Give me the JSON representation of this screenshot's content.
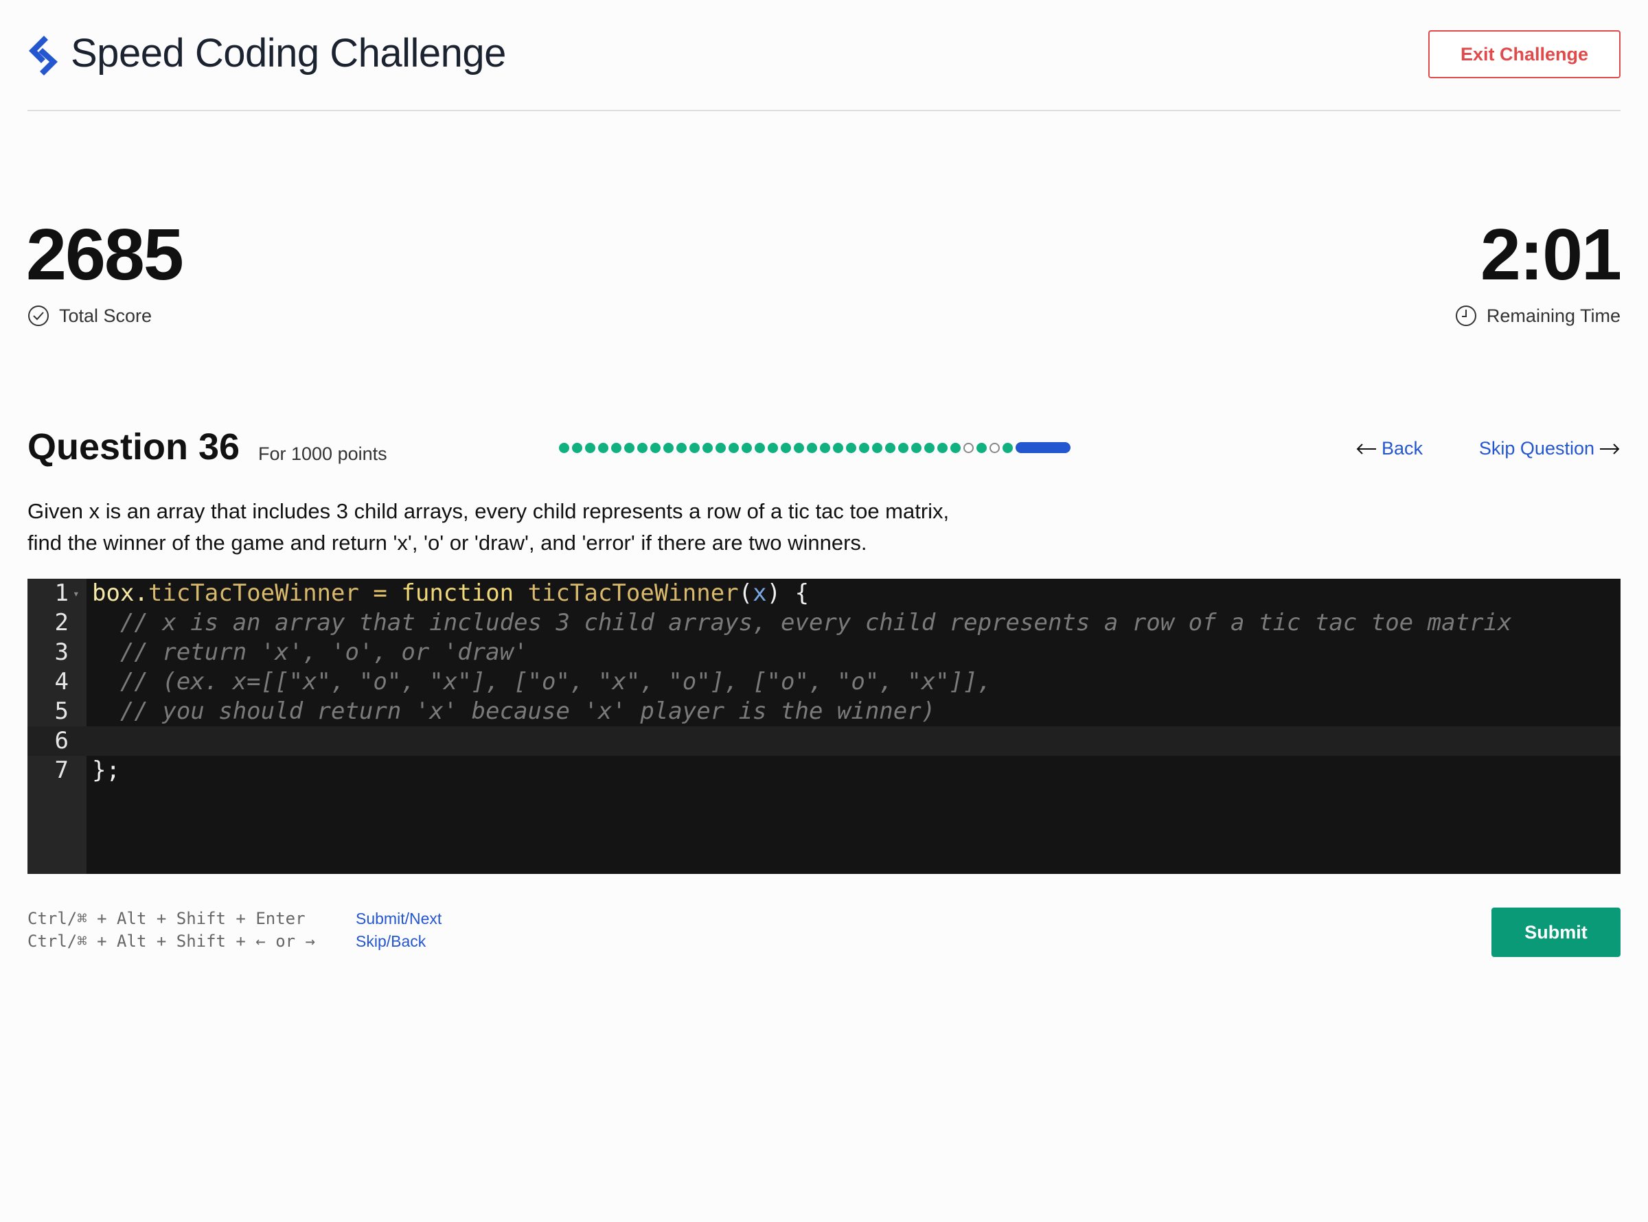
{
  "header": {
    "title": "Speed Coding Challenge",
    "exit_label": "Exit Challenge"
  },
  "stats": {
    "score": "2685",
    "score_label": "Total Score",
    "time": "2:01",
    "time_label": "Remaining Time"
  },
  "question": {
    "title": "Question 36",
    "points": "For 1000 points",
    "back_label": "Back",
    "skip_label": "Skip Question",
    "description_1": "Given x is an array that includes 3 child arrays, every child represents a row of a tic tac toe matrix,",
    "description_2": "find the winner of the game and return 'x', 'o' or 'draw', and 'error' if there are two winners."
  },
  "progress": {
    "states": [
      "done",
      "done",
      "done",
      "done",
      "done",
      "done",
      "done",
      "done",
      "done",
      "done",
      "done",
      "done",
      "done",
      "done",
      "done",
      "done",
      "done",
      "done",
      "done",
      "done",
      "done",
      "done",
      "done",
      "done",
      "done",
      "done",
      "done",
      "done",
      "done",
      "done",
      "done",
      "skip",
      "done",
      "skip",
      "done",
      "current"
    ]
  },
  "editor": {
    "line_numbers": [
      "1",
      "2",
      "3",
      "4",
      "5",
      "6",
      "7"
    ],
    "lines": {
      "l1_obj": "box",
      "l1_dot": ".",
      "l1_prop": "ticTacToeWinner",
      "l1_eq": " = ",
      "l1_kw": "function",
      "l1_fn": " ticTacToeWinner",
      "l1_open": "(",
      "l1_param": "x",
      "l1_close": ") {",
      "l2": "  // x is an array that includes 3 child arrays, every child represents a row of a tic tac toe matrix",
      "l3": "  // return 'x', 'o', or 'draw'",
      "l4": "  // (ex. x=[[\"x\", \"o\", \"x\"], [\"o\", \"x\", \"o\"], [\"o\", \"o\", \"x\"]],",
      "l5": "  // you should return 'x' because 'x' player is the winner)",
      "l6": "",
      "l7": "};"
    }
  },
  "shortcuts": {
    "submit_keys": "Ctrl/⌘ + Alt + Shift + Enter",
    "submit_action": "Submit/Next",
    "skip_keys": "Ctrl/⌘ + Alt + Shift + ← or →",
    "skip_action": "Skip/Back"
  },
  "submit_label": "Submit",
  "colors": {
    "accent_blue": "#2456cf",
    "success_green": "#10b080",
    "submit_green": "#0a9a78",
    "danger_red": "#e04a4a"
  }
}
